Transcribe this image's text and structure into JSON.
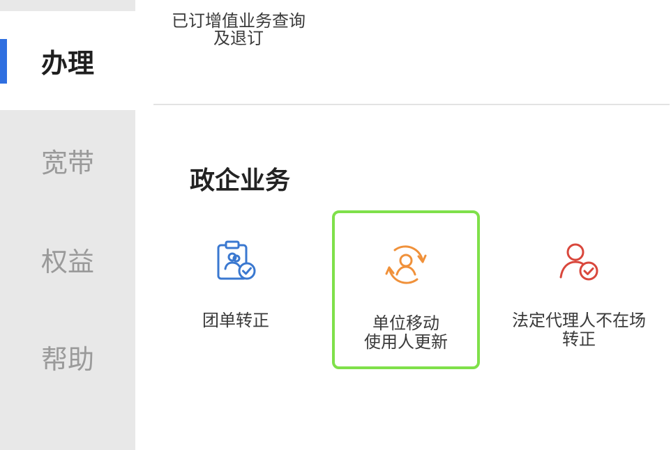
{
  "sidebar": {
    "items": [
      {
        "label": "办理",
        "active": true
      },
      {
        "label": "宽带",
        "active": false
      },
      {
        "label": "权益",
        "active": false
      },
      {
        "label": "帮助",
        "active": false
      }
    ]
  },
  "main": {
    "prev_item": {
      "label": "已订增值业务查询\n及退订"
    },
    "section": {
      "title": "政企业务",
      "items": [
        {
          "label": "团单转正",
          "icon": "clipboard-user-check-icon",
          "color": "#3a78d0"
        },
        {
          "label": "单位移动\n使用人更新",
          "icon": "user-refresh-icon",
          "color": "#f0913a",
          "highlighted": true
        },
        {
          "label": "法定代理人不在场\n转正",
          "icon": "user-check-icon",
          "color": "#d9473c"
        }
      ]
    }
  },
  "colors": {
    "accent": "#2f6fe0",
    "highlight_border": "#7fe04a",
    "sidebar_bg": "#e8e8e8"
  }
}
